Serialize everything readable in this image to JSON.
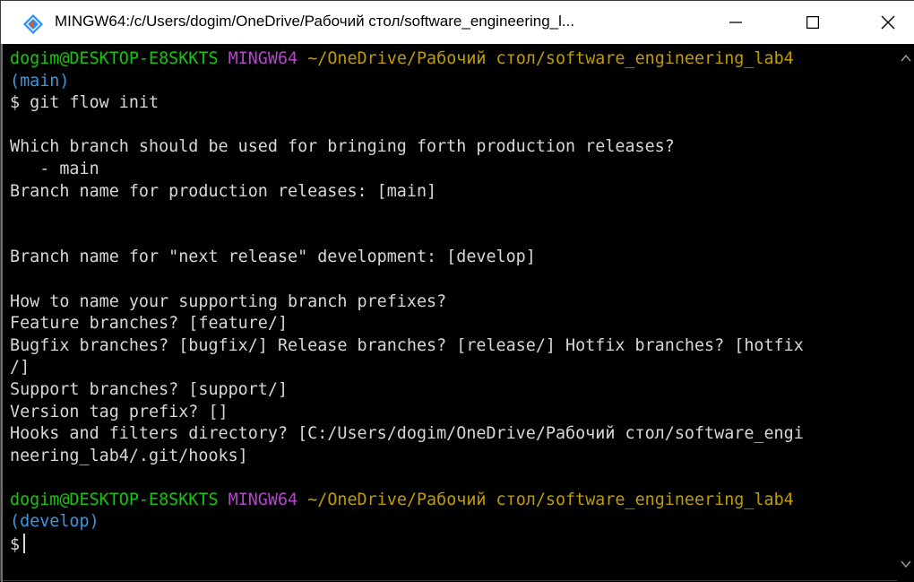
{
  "window": {
    "title": "MINGW64:/c/Users/dogim/OneDrive/Рабочий стол/software_engineering_l...",
    "icon": "git-bash-icon",
    "controls": {
      "minimize": "—",
      "maximize": "☐",
      "close": "✕"
    }
  },
  "terminal": {
    "prompt1": {
      "user": "dogim@DESKTOP-E8SKKTS",
      "host": "MINGW64",
      "path": "~/OneDrive/Рабочий стол/software_engineering_lab4",
      "branch": "(main)",
      "symbol": "$",
      "command": "git flow init"
    },
    "output": [
      "",
      "Which branch should be used for bringing forth production releases?",
      "   - main",
      "Branch name for production releases: [main]",
      "",
      "",
      "Branch name for \"next release\" development: [develop]",
      "",
      "How to name your supporting branch prefixes?",
      "Feature branches? [feature/]",
      "Bugfix branches? [bugfix/] Release branches? [release/] Hotfix branches? [hotfix",
      "/]",
      "Support branches? [support/]",
      "Version tag prefix? []",
      "Hooks and filters directory? [C:/Users/dogim/OneDrive/Рабочий стол/software_engi",
      "neering_lab4/.git/hooks]",
      ""
    ],
    "prompt2": {
      "user": "dogim@DESKTOP-E8SKKTS",
      "host": "MINGW64",
      "path": "~/OneDrive/Рабочий стол/software_engineering_lab4",
      "branch": "(develop)",
      "symbol": "$"
    }
  },
  "colors": {
    "user": "#16c60c",
    "host": "#b148c6",
    "path": "#c19c00",
    "branch": "#3a96dd",
    "text": "#d7d7d7",
    "background": "#000000"
  }
}
